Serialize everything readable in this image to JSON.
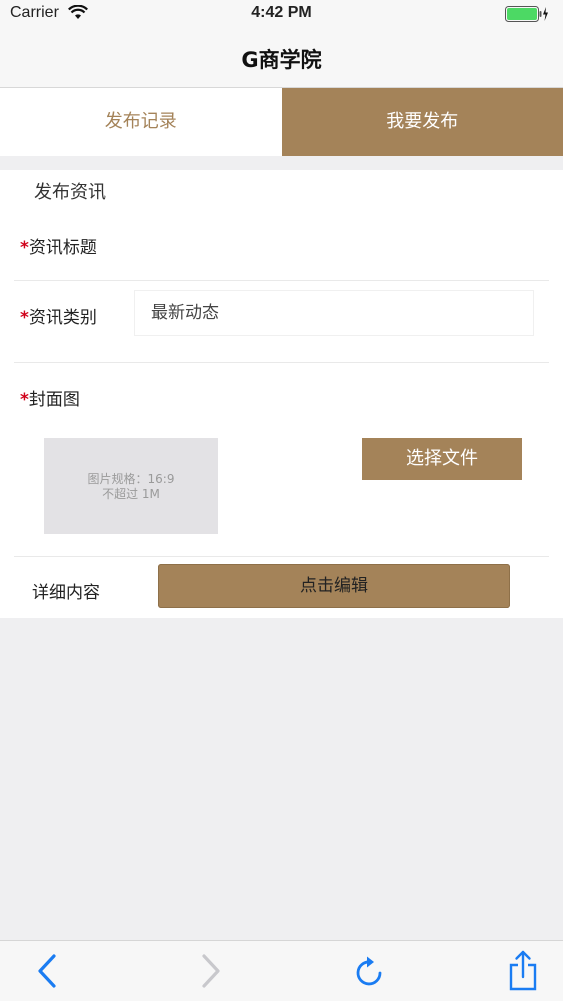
{
  "status_bar": {
    "carrier": "Carrier",
    "time": "4:42 PM"
  },
  "nav": {
    "title": "G商学院"
  },
  "tabs": [
    {
      "label": "发布记录",
      "active": false
    },
    {
      "label": "我要发布",
      "active": true
    }
  ],
  "form": {
    "section_title": "发布资讯",
    "required_mark": "*",
    "title_label": "资讯标题",
    "category_label": "资讯类别",
    "category_value": "最新动态",
    "cover_label": "封面图",
    "cover_hint_line1": "图片规格：16:9",
    "cover_hint_line2": "不超过 1M",
    "choose_file_label": "选择文件",
    "detail_label": "详细内容",
    "edit_button_label": "点击编辑"
  },
  "toolbar": {
    "icons": [
      "back-icon",
      "forward-icon",
      "reload-icon",
      "share-icon"
    ]
  },
  "colors": {
    "accent": "#a48359",
    "required": "#d0021b",
    "ios_blue": "#1a7cf2"
  }
}
